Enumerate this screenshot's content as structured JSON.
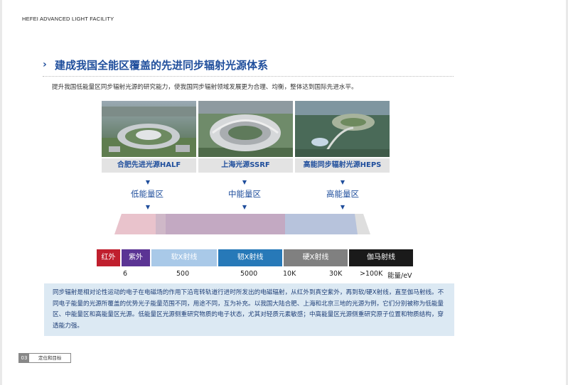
{
  "header": "HEFEI ADVANCED LIGHT FACILITY",
  "title": "建成我国全能区覆盖的先进同步辐射光源体系",
  "subtitle": "提升我国低能量区同步辐射光源的研究能力，使我国同步辐射领域发展更为合理、均衡，整体达到国际先进水平。",
  "facilities": [
    {
      "name": "合肥先进光源HALF",
      "level": "低能量区"
    },
    {
      "name": "上海光源SSRF",
      "level": "中能量区"
    },
    {
      "name": "高能同步辐射光源HEPS",
      "level": "高能量区"
    }
  ],
  "colors": {
    "accent": "#1f4e9c",
    "note_bg": "#dce9f3"
  },
  "spectrum": [
    {
      "label": "红外",
      "color": "#c01f2e"
    },
    {
      "label": "紫外",
      "color": "#5b3494"
    },
    {
      "label": "软X射线",
      "color": "#a9c9e8"
    },
    {
      "label": "韧X射线",
      "color": "#2779b8"
    },
    {
      "label": "硬X射线",
      "color": "#808080"
    },
    {
      "label": "伽马射线",
      "color": "#1a1a1a"
    }
  ],
  "ticks": [
    "6",
    "500",
    "5000",
    "10K",
    "30K",
    ">100K"
  ],
  "unit": "能量/eV",
  "note": "同步辐射是相对论性运动的电子在电磁场的作用下沿弯转轨道行进时所发出的电磁辐射，从红外到真空紫外，再到软/硬X射线，直至伽马射线。不同电子能量的光源所覆盖的优势光子能量范围不同，用途不同，互为补充。以我国大陆合肥、上海和北京三地的光源为例，它们分别被称为低能量区、中能量区和高能量区光源。低能量区光源侧重研究物质的电子状态，尤其对轻质元素敏感；中高能量区光源侧重研究原子位置和物质结构，穿透能力强。",
  "footer": {
    "page": "03",
    "label": "定位和目标"
  }
}
